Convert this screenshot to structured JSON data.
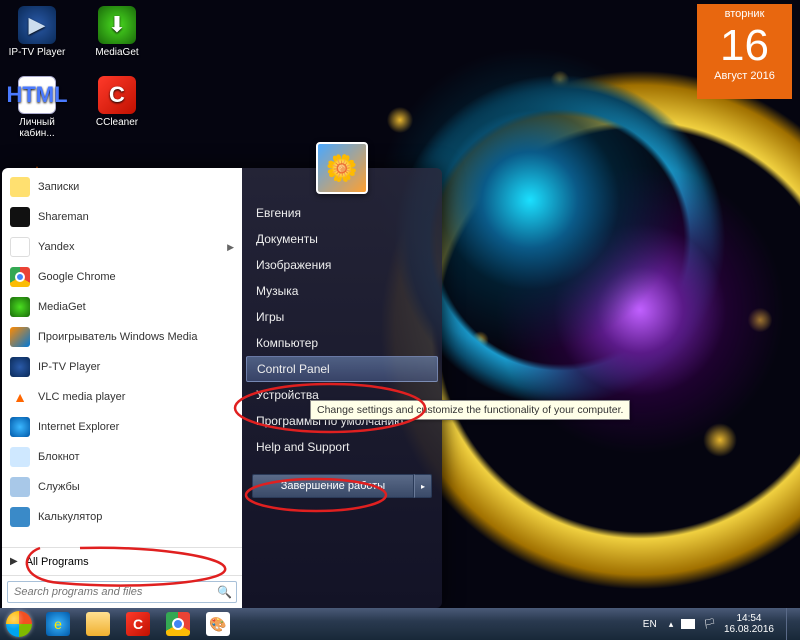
{
  "desktop_icons": [
    {
      "name": "iptv",
      "label": "IP-TV Player"
    },
    {
      "name": "mediaget",
      "label": "MediaGet"
    },
    {
      "name": "html",
      "label": "Личный кабин...",
      "glyph": "HTML"
    },
    {
      "name": "ccleaner",
      "label": "CCleaner",
      "glyph": "C"
    }
  ],
  "date_gadget": {
    "dow": "вторник",
    "day": "16",
    "month_year": "Август 2016"
  },
  "start_menu": {
    "programs": [
      {
        "id": "notes",
        "label": "Записки",
        "icon": "pi-notes"
      },
      {
        "id": "shareman",
        "label": "Shareman",
        "icon": "pi-shareman"
      },
      {
        "id": "yandex",
        "label": "Yandex",
        "icon": "pi-yandex",
        "submenu": true
      },
      {
        "id": "chrome",
        "label": "Google Chrome",
        "icon": "pi-chrome"
      },
      {
        "id": "mediaget",
        "label": "MediaGet",
        "icon": "pi-mediaget"
      },
      {
        "id": "wmp",
        "label": "Проигрыватель Windows Media",
        "icon": "pi-wmp"
      },
      {
        "id": "iptv",
        "label": "IP-TV Player",
        "icon": "pi-iptv"
      },
      {
        "id": "vlc",
        "label": "VLC media player",
        "icon": "pi-vlc",
        "glyph": "▲"
      },
      {
        "id": "ie",
        "label": "Internet Explorer",
        "icon": "pi-ie"
      },
      {
        "id": "notepad",
        "label": "Блокнот",
        "icon": "pi-notepad"
      },
      {
        "id": "services",
        "label": "Службы",
        "icon": "pi-services"
      },
      {
        "id": "calc",
        "label": "Калькулятор",
        "icon": "pi-calc"
      }
    ],
    "all_programs": "All Programs",
    "search_placeholder": "Search programs and files",
    "right": {
      "user": "Евгения",
      "items": [
        {
          "id": "documents",
          "label": "Документы"
        },
        {
          "id": "pictures",
          "label": "Изображения"
        },
        {
          "id": "music",
          "label": "Музыка"
        },
        {
          "id": "games",
          "label": "Игры"
        },
        {
          "id": "computer",
          "label": "Компьютер"
        },
        {
          "id": "controlpanel",
          "label": "Control Panel",
          "highlight": true
        },
        {
          "id": "devices",
          "label": "Устройства"
        },
        {
          "id": "defaults",
          "label": "Программы по умолчанию"
        },
        {
          "id": "help",
          "label": "Help and Support"
        }
      ],
      "shutdown": "Завершение работы"
    }
  },
  "tooltip": "Change settings and customize the functionality of your computer.",
  "taskbar": {
    "lang": "EN",
    "time": "14:54",
    "date": "16.08.2016"
  }
}
